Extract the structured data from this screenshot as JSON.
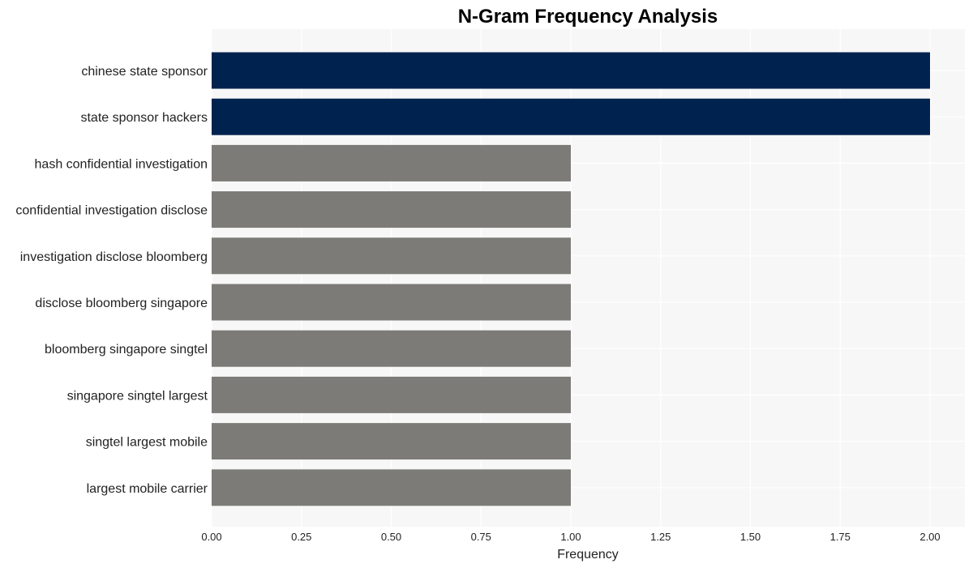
{
  "chart_data": {
    "type": "bar",
    "orientation": "horizontal",
    "title": "N-Gram Frequency Analysis",
    "xlabel": "Frequency",
    "ylabel": "",
    "xlim": [
      0,
      2.1
    ],
    "x_ticks": [
      "0.00",
      "0.25",
      "0.50",
      "0.75",
      "1.00",
      "1.25",
      "1.50",
      "1.75",
      "2.00"
    ],
    "x_tick_values": [
      0,
      0.25,
      0.5,
      0.75,
      1.0,
      1.25,
      1.5,
      1.75,
      2.0
    ],
    "grid": true,
    "categories": [
      "chinese state sponsor",
      "state sponsor hackers",
      "hash confidential investigation",
      "confidential investigation disclose",
      "investigation disclose bloomberg",
      "disclose bloomberg singapore",
      "bloomberg singapore singtel",
      "singapore singtel largest",
      "singtel largest mobile",
      "largest mobile carrier"
    ],
    "values": [
      2,
      2,
      1,
      1,
      1,
      1,
      1,
      1,
      1,
      1
    ],
    "colors": {
      "highlight": "#00224e",
      "default": "#7c7b77",
      "plot_background": "#f7f7f7",
      "grid": "#ffffff"
    }
  }
}
